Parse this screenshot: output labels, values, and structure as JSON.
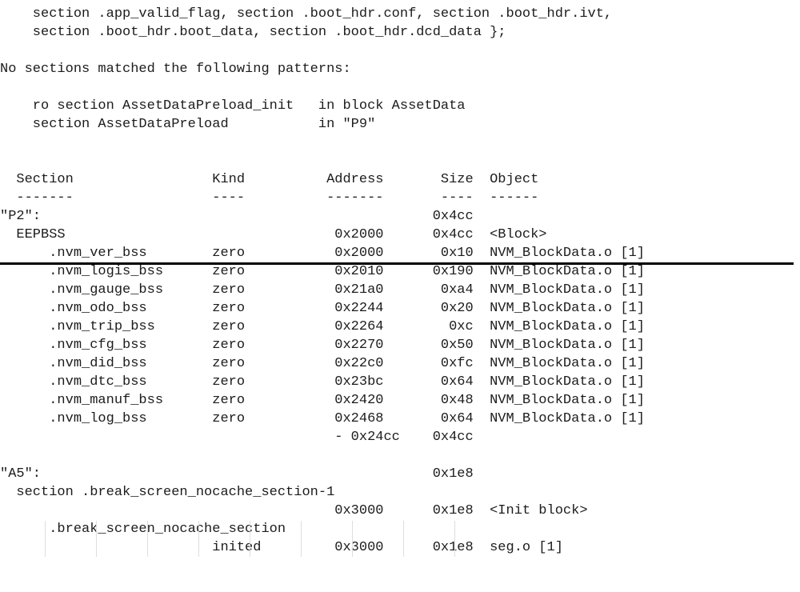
{
  "top_lines": [
    "    section .app_valid_flag, section .boot_hdr.conf, section .boot_hdr.ivt,",
    "    section .boot_hdr.boot_data, section .boot_hdr.dcd_data };"
  ],
  "no_match_heading": "No sections matched the following patterns:",
  "no_match_lines": [
    "    ro section AssetDataPreload_init   in block AssetData",
    "    section AssetDataPreload           in \"P9\""
  ],
  "header": {
    "section": "Section",
    "kind": "Kind",
    "address": "Address",
    "size": "Size",
    "object": "Object"
  },
  "dashes": {
    "section": "-------",
    "kind": "----",
    "address": "-------",
    "size": "----",
    "object": "------"
  },
  "p2": {
    "label": "\"P2\":",
    "label_size": "0x4cc",
    "eepbss": {
      "name": "EEPBSS",
      "address": "0x2000",
      "size": "0x4cc",
      "object": "<Block>"
    },
    "rows": [
      {
        "section": ".nvm_ver_bss",
        "kind": "zero",
        "address": "0x2000",
        "size": "0x10",
        "object": "NVM_BlockData.o [1]"
      },
      {
        "section": ".nvm_logis_bss",
        "kind": "zero",
        "address": "0x2010",
        "size": "0x190",
        "object": "NVM_BlockData.o [1]"
      },
      {
        "section": ".nvm_gauge_bss",
        "kind": "zero",
        "address": "0x21a0",
        "size": "0xa4",
        "object": "NVM_BlockData.o [1]"
      },
      {
        "section": ".nvm_odo_bss",
        "kind": "zero",
        "address": "0x2244",
        "size": "0x20",
        "object": "NVM_BlockData.o [1]"
      },
      {
        "section": ".nvm_trip_bss",
        "kind": "zero",
        "address": "0x2264",
        "size": "0xc",
        "object": "NVM_BlockData.o [1]"
      },
      {
        "section": ".nvm_cfg_bss",
        "kind": "zero",
        "address": "0x2270",
        "size": "0x50",
        "object": "NVM_BlockData.o [1]"
      },
      {
        "section": ".nvm_did_bss",
        "kind": "zero",
        "address": "0x22c0",
        "size": "0xfc",
        "object": "NVM_BlockData.o [1]"
      },
      {
        "section": ".nvm_dtc_bss",
        "kind": "zero",
        "address": "0x23bc",
        "size": "0x64",
        "object": "NVM_BlockData.o [1]"
      },
      {
        "section": ".nvm_manuf_bss",
        "kind": "zero",
        "address": "0x2420",
        "size": "0x48",
        "object": "NVM_BlockData.o [1]"
      },
      {
        "section": ".nvm_log_bss",
        "kind": "zero",
        "address": "0x2468",
        "size": "0x64",
        "object": "NVM_BlockData.o [1]"
      }
    ],
    "trailer": {
      "address": "- 0x24cc",
      "size": "0x4cc"
    }
  },
  "a5": {
    "label": "\"A5\":",
    "label_size": "0x1e8",
    "sub_heading": "section .break_screen_nocache_section-1",
    "row1": {
      "address": "0x3000",
      "size": "0x1e8",
      "object": "<Init block>"
    },
    "name2": ".break_screen_nocache_section",
    "row2": {
      "kind": "inited",
      "address": "0x3000",
      "size": "0x1e8",
      "object": "seg.o [1]"
    }
  },
  "cols": {
    "leftIndent": 2,
    "sectionPad": 24,
    "kindPad": 14,
    "addressPad": 10,
    "sizePad": 8,
    "rowNamePad": 20,
    "rowNameIndent": 6
  }
}
